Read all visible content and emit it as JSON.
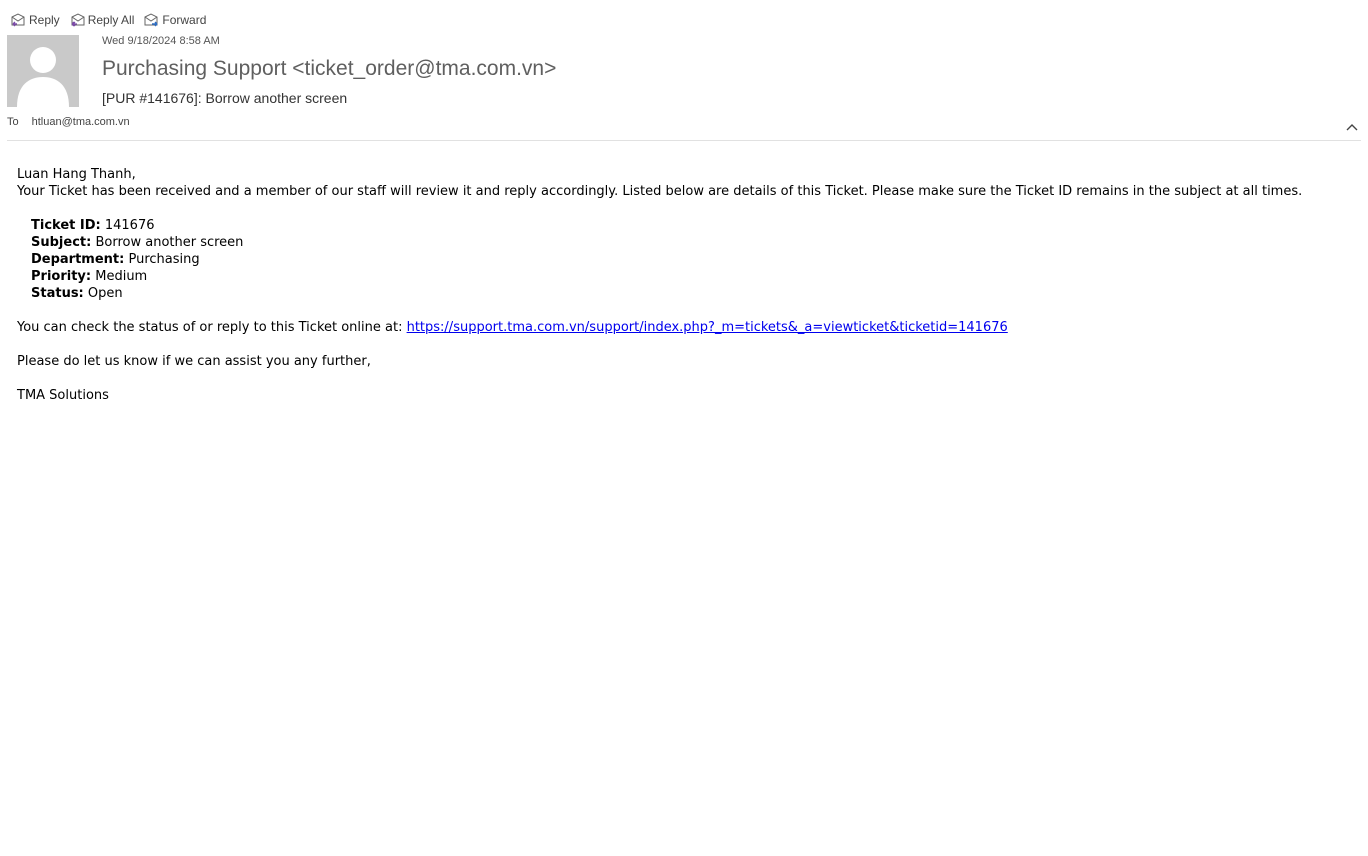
{
  "toolbar": {
    "reply_label": "Reply",
    "reply_all_label": "Reply All",
    "forward_label": "Forward"
  },
  "header": {
    "date": "Wed 9/18/2024 8:58 AM",
    "sender": "Purchasing Support <ticket_order@tma.com.vn>",
    "subject": "[PUR #141676]: Borrow another screen",
    "to_label": "To",
    "to_value": "htluan@tma.com.vn"
  },
  "message": {
    "greeting": "Luan Hang Thanh,",
    "intro": "Your Ticket has been received and a member of our staff will review it and reply accordingly. Listed below are details of this Ticket. Please make sure the Ticket ID remains in the subject at all times.",
    "details": [
      {
        "label": "Ticket ID:",
        "value": "141676"
      },
      {
        "label": "Subject:",
        "value": "Borrow another screen"
      },
      {
        "label": "Department:",
        "value": "Purchasing"
      },
      {
        "label": "Priority:",
        "value": "Medium"
      },
      {
        "label": "Status:",
        "value": "Open"
      }
    ],
    "status_text": "You can check the status of or reply to this Ticket online at: ",
    "status_link": "https://support.tma.com.vn/support/index.php?_m=tickets&_a=viewticket&ticketid=141676",
    "closing": "Please do let us know if we can assist you any further,",
    "signature": "TMA Solutions"
  },
  "icons": {
    "reply": "reply-icon",
    "reply_all": "reply-all-icon",
    "forward": "forward-icon",
    "collapse": "chevron-up-icon",
    "avatar": "person-silhouette"
  }
}
